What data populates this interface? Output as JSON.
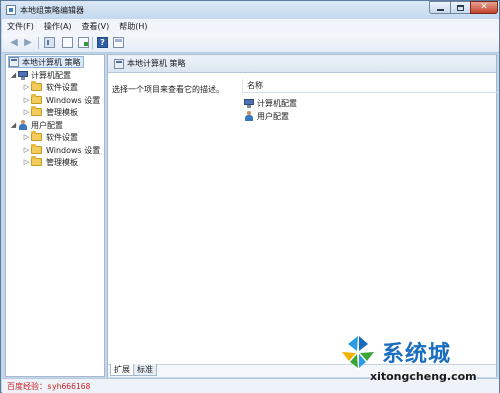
{
  "window": {
    "title": "本地组策略编辑器"
  },
  "menu": {
    "items": [
      "文件(F)",
      "操作(A)",
      "查看(V)",
      "帮助(H)"
    ]
  },
  "toolbar": {
    "help_glyph": "?"
  },
  "tree": {
    "root": "本地计算机 策略",
    "computer_config": "计算机配置",
    "user_config": "用户配置",
    "computer_children": [
      "软件设置",
      "Windows 设置",
      "管理模板"
    ],
    "user_children": [
      "软件设置",
      "Windows 设置",
      "管理模板"
    ]
  },
  "right": {
    "header_title": "本地计算机 策略",
    "description": "选择一个项目来查看它的描述。",
    "column_name": "名称",
    "items": [
      "计算机配置",
      "用户配置"
    ]
  },
  "tabs": [
    "扩展",
    "标准"
  ],
  "status": {
    "text": "百度经验：syh666168"
  },
  "watermark": {
    "brand": "系统城",
    "url": "xitongcheng.com"
  },
  "colors": {
    "frame": "#c2d6ec",
    "status_text": "#cc1d1d",
    "brand": "#1b6dc0"
  }
}
